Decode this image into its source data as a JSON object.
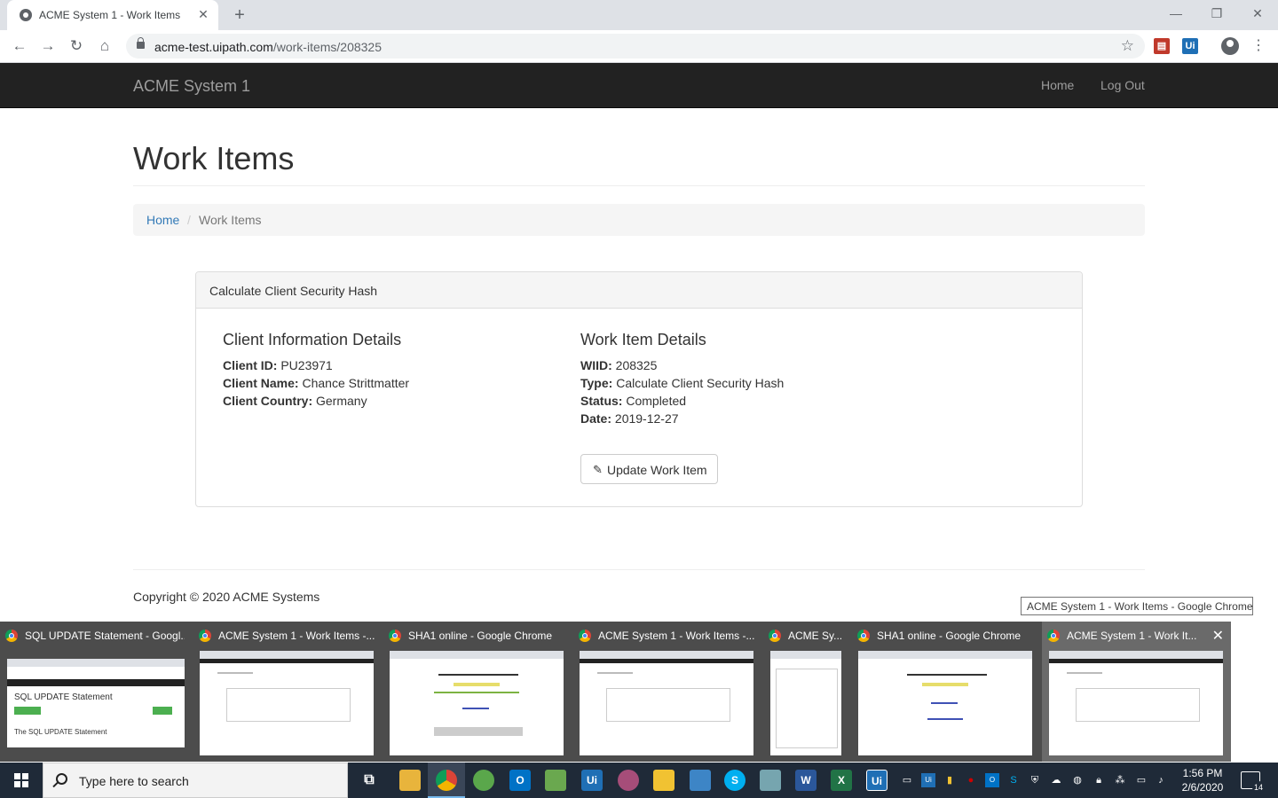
{
  "browser": {
    "tab_title": "ACME System 1 - Work Items",
    "url_host": "acme-test.uipath.com",
    "url_path": "/work-items/208325",
    "new_tab": "+",
    "close_tab": "✕"
  },
  "site": {
    "brand": "ACME System 1",
    "nav": {
      "home": "Home",
      "logout": "Log Out"
    }
  },
  "page": {
    "title": "Work Items",
    "breadcrumb": {
      "home": "Home",
      "separator": "/",
      "current": "Work Items"
    }
  },
  "panel": {
    "heading": "Calculate Client Security Hash",
    "client": {
      "title": "Client Information Details",
      "id_label": "Client ID:",
      "id_value": "PU23971",
      "name_label": "Client Name:",
      "name_value": "Chance Strittmatter",
      "country_label": "Client Country:",
      "country_value": "Germany"
    },
    "work_item": {
      "title": "Work Item Details",
      "wiid_label": "WIID:",
      "wiid_value": "208325",
      "type_label": "Type:",
      "type_value": "Calculate Client Security Hash",
      "status_label": "Status:",
      "status_value": "Completed",
      "date_label": "Date:",
      "date_value": "2019-12-27"
    },
    "update_button": "Update Work Item"
  },
  "footer": {
    "copyright": "Copyright © 2020 ACME Systems"
  },
  "tooltip": "ACME System 1 - Work Items - Google Chrome",
  "thumbnails": [
    {
      "title": "SQL UPDATE Statement - Googl...",
      "preview_heading": "SQL UPDATE Statement",
      "preview_sub": "The SQL UPDATE Statement"
    },
    {
      "title": "ACME System 1 - Work Items -..."
    },
    {
      "title": "SHA1 online - Google Chrome"
    },
    {
      "title": "ACME System 1 - Work Items -..."
    },
    {
      "title": "ACME Sy..."
    },
    {
      "title": "SHA1 online - Google Chrome"
    },
    {
      "title": "ACME System 1 - Work It..."
    }
  ],
  "taskbar": {
    "search_placeholder": "Type here to search",
    "time": "1:56 PM",
    "date": "2/6/2020",
    "notifications": "14"
  },
  "colors": {
    "navbar_bg": "#222222",
    "link": "#337ab7",
    "taskbar_bg": "#1f2a38"
  }
}
